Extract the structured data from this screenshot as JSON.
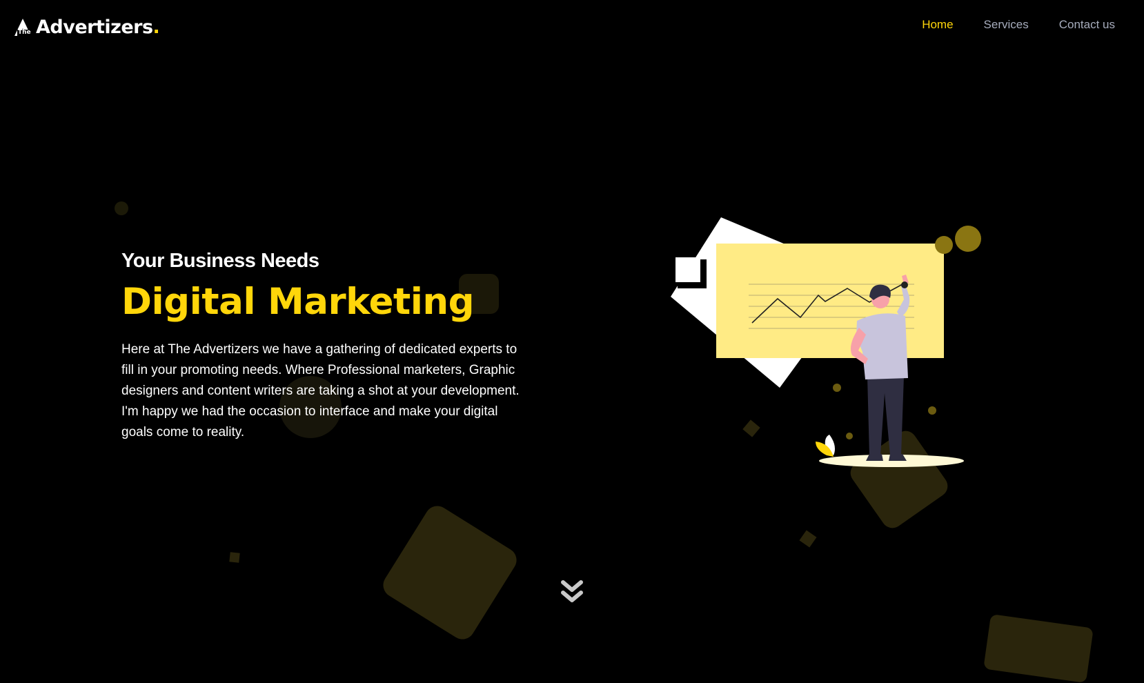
{
  "brand": {
    "logo_prefix": "The",
    "logo_text": "Advertizers",
    "logo_dot": ".",
    "accent_color": "#ffd60a",
    "background_color": "#000000"
  },
  "nav": {
    "items": [
      {
        "label": "Home",
        "active": true
      },
      {
        "label": "Services",
        "active": false
      },
      {
        "label": "Contact us",
        "active": false
      }
    ]
  },
  "hero": {
    "subtitle": "Your Business Needs",
    "title": "Digital Marketing",
    "description": "Here at The Advertizers we have a gathering of dedicated experts to fill in your promoting needs. Where Professional marketers, Graphic designers and content writers are taking a shot at your development. I'm happy we had the occasion to interface and make your digital goals come to reality."
  },
  "icons": {
    "scroll_down": "double-chevron-down-icon",
    "illustration": "man-drawing-chart-illustration"
  }
}
